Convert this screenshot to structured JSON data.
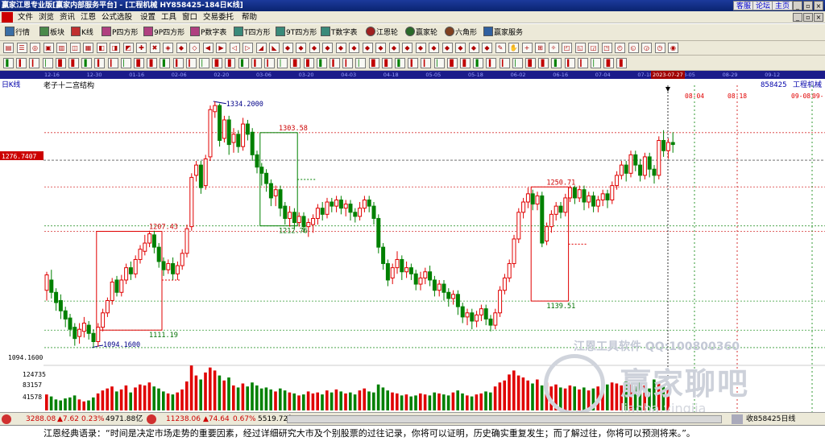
{
  "window": {
    "title": "赢家江恩专业版[赢家内部服务平台] - [工程机械  HY858425-184日K线]",
    "buttons": [
      "客服",
      "论坛",
      "主页"
    ],
    "controls": [
      "_",
      "▫",
      "×"
    ],
    "subcontrols": [
      "_",
      "▫",
      "×"
    ]
  },
  "menu": [
    "文件",
    "浏览",
    "资讯",
    "江恩",
    "公式选股",
    "设置",
    "工具",
    "窗口",
    "交易委托",
    "帮助"
  ],
  "toolbar": [
    "行情",
    "板块",
    "K线",
    "P四方形",
    "9P四方形",
    "P数字表",
    "T四方形",
    "9T四方形",
    "T数字表",
    "江恩轮",
    "赢家轮",
    "六角形",
    "赢家服务"
  ],
  "date_axis": {
    "labels": [
      "12-16",
      "12-30",
      "01-16",
      "02-06",
      "02-20",
      "03-06",
      "03-20",
      "04-03",
      "04-18",
      "05-05",
      "05-18",
      "06-02",
      "06-16",
      "07-04",
      "07-18",
      "08-05",
      "08-29",
      "09-12"
    ],
    "current": "2023-07-27"
  },
  "chart_header": {
    "period": "日K线",
    "code": "858425",
    "name": "工程机械",
    "study": "老子十二宫结构",
    "future_dates": [
      "08-04",
      "08-18",
      "09-08",
      "09-"
    ]
  },
  "price_axis": {
    "cursor_price": "1276.7407",
    "low_label": "1094.1600",
    "volume_labels": [
      "124735",
      "83157",
      "41578"
    ]
  },
  "annotations": {
    "high": "1334.2000",
    "low": "1094.1600",
    "box1_top": "1207.43",
    "box1_bottom": "1111.19",
    "box2_top": "1303.58",
    "box2_bottom": "1212.76",
    "box3_top": "1250.71",
    "box3_bottom": "1139.51"
  },
  "chart_data": {
    "type": "candlestick",
    "ylim": [
      1080,
      1345
    ],
    "candles": [
      [
        1150,
        1165,
        1140,
        1168
      ],
      [
        1160,
        1148,
        1142,
        1170
      ],
      [
        1148,
        1138,
        1130,
        1152
      ],
      [
        1140,
        1130,
        1122,
        1146
      ],
      [
        1130,
        1122,
        1114,
        1134
      ],
      [
        1123,
        1112,
        1105,
        1127
      ],
      [
        1114,
        1103,
        1096,
        1118
      ],
      [
        1105,
        1112,
        1098,
        1118
      ],
      [
        1110,
        1118,
        1104,
        1124
      ],
      [
        1116,
        1108,
        1102,
        1120
      ],
      [
        1108,
        1100,
        1094,
        1112
      ],
      [
        1100,
        1114,
        1095,
        1118
      ],
      [
        1114,
        1128,
        1110,
        1132
      ],
      [
        1128,
        1140,
        1124,
        1143
      ],
      [
        1140,
        1158,
        1136,
        1162
      ],
      [
        1160,
        1148,
        1144,
        1164
      ],
      [
        1148,
        1160,
        1144,
        1165
      ],
      [
        1160,
        1172,
        1156,
        1176
      ],
      [
        1172,
        1166,
        1160,
        1178
      ],
      [
        1166,
        1180,
        1162,
        1184
      ],
      [
        1180,
        1190,
        1176,
        1194
      ],
      [
        1188,
        1196,
        1184,
        1204
      ],
      [
        1196,
        1205,
        1192,
        1208
      ],
      [
        1204,
        1192,
        1186,
        1208
      ],
      [
        1192,
        1178,
        1172,
        1196
      ],
      [
        1178,
        1170,
        1164,
        1182
      ],
      [
        1170,
        1176,
        1166,
        1180
      ],
      [
        1176,
        1166,
        1160,
        1182
      ],
      [
        1166,
        1174,
        1160,
        1178
      ],
      [
        1174,
        1186,
        1170,
        1190
      ],
      [
        1186,
        1210,
        1182,
        1214
      ],
      [
        1212,
        1260,
        1208,
        1264
      ],
      [
        1262,
        1272,
        1256,
        1276
      ],
      [
        1272,
        1250,
        1244,
        1276
      ],
      [
        1252,
        1278,
        1248,
        1282
      ],
      [
        1280,
        1326,
        1276,
        1330
      ],
      [
        1324,
        1330,
        1318,
        1334
      ],
      [
        1330,
        1296,
        1290,
        1332
      ],
      [
        1298,
        1316,
        1294,
        1320
      ],
      [
        1316,
        1292,
        1282,
        1320
      ],
      [
        1294,
        1302,
        1284,
        1308
      ],
      [
        1302,
        1290,
        1284,
        1306
      ],
      [
        1290,
        1312,
        1286,
        1318
      ],
      [
        1312,
        1302,
        1296,
        1316
      ],
      [
        1304,
        1282,
        1276,
        1308
      ],
      [
        1282,
        1270,
        1264,
        1286
      ],
      [
        1270,
        1264,
        1252,
        1274
      ],
      [
        1264,
        1254,
        1246,
        1268
      ],
      [
        1254,
        1240,
        1232,
        1258
      ],
      [
        1242,
        1248,
        1232,
        1252
      ],
      [
        1248,
        1230,
        1222,
        1252
      ],
      [
        1232,
        1220,
        1214,
        1236
      ],
      [
        1220,
        1226,
        1212,
        1232
      ],
      [
        1226,
        1216,
        1210,
        1230
      ],
      [
        1216,
        1222,
        1212,
        1226
      ],
      [
        1222,
        1212,
        1206,
        1226
      ],
      [
        1212,
        1216,
        1202,
        1220
      ],
      [
        1214,
        1220,
        1206,
        1224
      ],
      [
        1220,
        1230,
        1214,
        1234
      ],
      [
        1230,
        1224,
        1218,
        1236
      ],
      [
        1224,
        1236,
        1220,
        1240
      ],
      [
        1236,
        1232,
        1226,
        1240
      ],
      [
        1232,
        1238,
        1226,
        1242
      ],
      [
        1238,
        1230,
        1224,
        1242
      ],
      [
        1230,
        1234,
        1222,
        1238
      ],
      [
        1234,
        1226,
        1218,
        1238
      ],
      [
        1226,
        1222,
        1216,
        1230
      ],
      [
        1222,
        1230,
        1218,
        1236
      ],
      [
        1230,
        1238,
        1226,
        1242
      ],
      [
        1238,
        1232,
        1226,
        1242
      ],
      [
        1232,
        1220,
        1214,
        1236
      ],
      [
        1220,
        1192,
        1186,
        1224
      ],
      [
        1192,
        1176,
        1170,
        1196
      ],
      [
        1176,
        1160,
        1154,
        1180
      ],
      [
        1162,
        1172,
        1156,
        1176
      ],
      [
        1172,
        1180,
        1166,
        1188
      ],
      [
        1180,
        1168,
        1160,
        1184
      ],
      [
        1168,
        1172,
        1162,
        1178
      ],
      [
        1172,
        1166,
        1160,
        1176
      ],
      [
        1166,
        1156,
        1150,
        1170
      ],
      [
        1156,
        1162,
        1150,
        1168
      ],
      [
        1162,
        1168,
        1156,
        1172
      ],
      [
        1168,
        1160,
        1154,
        1174
      ],
      [
        1160,
        1150,
        1144,
        1164
      ],
      [
        1150,
        1156,
        1144,
        1160
      ],
      [
        1156,
        1148,
        1140,
        1160
      ],
      [
        1148,
        1142,
        1134,
        1152
      ],
      [
        1142,
        1146,
        1136,
        1150
      ],
      [
        1146,
        1134,
        1126,
        1150
      ],
      [
        1134,
        1124,
        1118,
        1138
      ],
      [
        1124,
        1128,
        1116,
        1132
      ],
      [
        1128,
        1120,
        1112,
        1132
      ],
      [
        1120,
        1126,
        1114,
        1130
      ],
      [
        1126,
        1132,
        1120,
        1136
      ],
      [
        1132,
        1122,
        1116,
        1136
      ],
      [
        1122,
        1116,
        1110,
        1126
      ],
      [
        1116,
        1128,
        1112,
        1132
      ],
      [
        1128,
        1150,
        1124,
        1154
      ],
      [
        1150,
        1162,
        1146,
        1166
      ],
      [
        1162,
        1176,
        1158,
        1180
      ],
      [
        1176,
        1200,
        1172,
        1204
      ],
      [
        1200,
        1226,
        1196,
        1230
      ],
      [
        1226,
        1236,
        1220,
        1240
      ],
      [
        1236,
        1244,
        1230,
        1250
      ],
      [
        1244,
        1234,
        1228,
        1248
      ],
      [
        1234,
        1242,
        1228,
        1246
      ],
      [
        1242,
        1196,
        1192,
        1246
      ],
      [
        1198,
        1212,
        1194,
        1216
      ],
      [
        1212,
        1224,
        1206,
        1228
      ],
      [
        1224,
        1232,
        1218,
        1236
      ],
      [
        1232,
        1226,
        1220,
        1236
      ],
      [
        1226,
        1240,
        1222,
        1244
      ],
      [
        1240,
        1250,
        1236,
        1252
      ],
      [
        1250,
        1240,
        1234,
        1252
      ],
      [
        1240,
        1248,
        1236,
        1252
      ],
      [
        1248,
        1236,
        1228,
        1252
      ],
      [
        1236,
        1242,
        1230,
        1246
      ],
      [
        1242,
        1232,
        1226,
        1246
      ],
      [
        1232,
        1238,
        1226,
        1242
      ],
      [
        1238,
        1244,
        1232,
        1248
      ],
      [
        1244,
        1238,
        1230,
        1248
      ],
      [
        1238,
        1252,
        1234,
        1256
      ],
      [
        1252,
        1262,
        1248,
        1266
      ],
      [
        1262,
        1272,
        1258,
        1276
      ],
      [
        1272,
        1264,
        1256,
        1276
      ],
      [
        1264,
        1282,
        1260,
        1286
      ],
      [
        1282,
        1272,
        1266,
        1286
      ],
      [
        1272,
        1262,
        1256,
        1278
      ],
      [
        1262,
        1280,
        1258,
        1284
      ],
      [
        1280,
        1268,
        1260,
        1284
      ],
      [
        1268,
        1262,
        1254,
        1272
      ],
      [
        1262,
        1296,
        1258,
        1300
      ],
      [
        1296,
        1286,
        1280,
        1306
      ],
      [
        1286,
        1294,
        1278,
        1298
      ],
      [
        1294,
        1292,
        1284,
        1304
      ]
    ],
    "volumes": [
      0.32,
      0.28,
      0.22,
      0.2,
      0.24,
      0.26,
      0.3,
      0.22,
      0.18,
      0.2,
      0.26,
      0.34,
      0.4,
      0.44,
      0.48,
      0.38,
      0.42,
      0.5,
      0.36,
      0.46,
      0.52,
      0.5,
      0.56,
      0.48,
      0.44,
      0.38,
      0.34,
      0.32,
      0.36,
      0.42,
      0.58,
      0.9,
      0.7,
      0.62,
      0.76,
      0.86,
      0.8,
      0.7,
      0.6,
      0.66,
      0.5,
      0.46,
      0.54,
      0.48,
      0.56,
      0.5,
      0.44,
      0.46,
      0.42,
      0.38,
      0.44,
      0.4,
      0.36,
      0.34,
      0.3,
      0.32,
      0.38,
      0.34,
      0.36,
      0.32,
      0.4,
      0.36,
      0.42,
      0.38,
      0.34,
      0.36,
      0.32,
      0.4,
      0.44,
      0.38,
      0.36,
      0.52,
      0.46,
      0.4,
      0.36,
      0.34,
      0.3,
      0.32,
      0.28,
      0.3,
      0.34,
      0.32,
      0.3,
      0.36,
      0.34,
      0.32,
      0.3,
      0.36,
      0.4,
      0.34,
      0.3,
      0.28,
      0.32,
      0.34,
      0.38,
      0.36,
      0.48,
      0.56,
      0.6,
      0.72,
      0.8,
      0.7,
      0.66,
      0.6,
      0.54,
      0.62,
      0.5,
      0.56,
      0.48,
      0.52,
      0.46,
      0.44,
      0.5,
      0.48,
      0.42,
      0.46,
      0.4,
      0.44,
      0.48,
      0.46,
      0.52,
      0.56,
      0.54,
      0.5,
      0.58,
      0.52,
      0.48,
      0.56,
      0.5,
      0.44,
      0.62,
      0.54,
      0.48,
      0.44
    ],
    "reference_lines": [
      1303.58,
      1276.7407,
      1250.71,
      1212.76,
      1207.43,
      1139.51,
      1111.19,
      1094.16
    ]
  },
  "status": {
    "sh_index": "3288.08",
    "sh_change": "▲7.62",
    "sh_pct": "0.23%",
    "sh_amount": "4971.88亿",
    "sz_index": "11238.06",
    "sz_change": "▲74.64",
    "sz_pct": "0.67%",
    "sz_amount": "5519.72亿",
    "right_text": "收858425日线"
  },
  "quote": "江恩经典语录：“时间是决定市场走势的重要因素，经过详细研究大市及个别股票的过往记录，你将可以证明，历史确实重复发生；而了解过往，你将可以预测将来。”。",
  "watermark": {
    "line1": "江恩工具软件 QQ:100800360",
    "line2": "赢家聊吧",
    "line3": "liaoba.yingjia"
  },
  "colors": {
    "up": "#e00000",
    "down": "#008000",
    "box_red": "#e00000",
    "box_green": "#008000",
    "title_bar": "#0a2470",
    "date_bar": "#1b1b8a"
  }
}
